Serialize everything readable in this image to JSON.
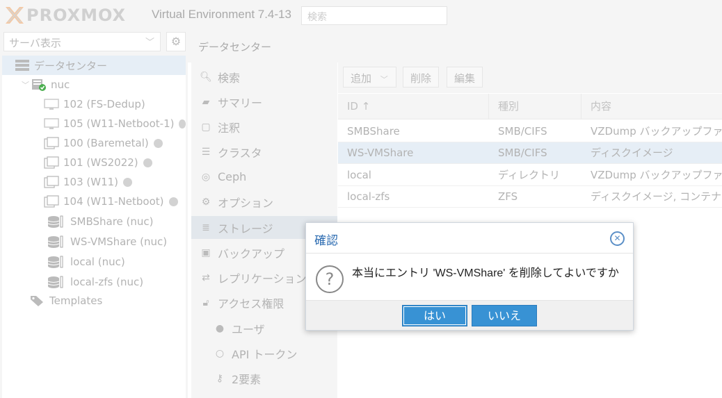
{
  "header": {
    "brand": "PROXMOX",
    "version": "Virtual Environment 7.4-13",
    "search_placeholder": "検索"
  },
  "left": {
    "view_selector": "サーバ表示",
    "tree": [
      {
        "label": "データセンター",
        "icon": "datacenter-icon"
      },
      {
        "label": "nuc",
        "icon": "node-online-icon"
      },
      {
        "label": "102 (FS-Dedup)",
        "icon": "vm-icon"
      },
      {
        "label": "105 (W11-Netboot-1)",
        "icon": "vm-icon"
      },
      {
        "label": "100 (Baremetal)",
        "icon": "template-icon"
      },
      {
        "label": "101 (WS2022)",
        "icon": "template-icon"
      },
      {
        "label": "103 (W11)",
        "icon": "template-icon"
      },
      {
        "label": "104 (W11-Netboot)",
        "icon": "template-icon"
      },
      {
        "label": "SMBShare (nuc)",
        "icon": "storage-icon"
      },
      {
        "label": "WS-VMShare (nuc)",
        "icon": "storage-icon"
      },
      {
        "label": "local (nuc)",
        "icon": "storage-icon"
      },
      {
        "label": "local-zfs (nuc)",
        "icon": "storage-icon"
      },
      {
        "label": "Templates",
        "icon": "tags-icon"
      }
    ]
  },
  "breadcrumb": "データセンター",
  "nav": [
    {
      "label": "検索",
      "icon": "search-icon"
    },
    {
      "label": "サマリー",
      "icon": "book-icon"
    },
    {
      "label": "注釈",
      "icon": "note-icon"
    },
    {
      "label": "クラスタ",
      "icon": "server-icon"
    },
    {
      "label": "Ceph",
      "icon": "ceph-icon"
    },
    {
      "label": "オプション",
      "icon": "gear-icon"
    },
    {
      "label": "ストレージ",
      "icon": "database-icon"
    },
    {
      "label": "バックアップ",
      "icon": "floppy-icon"
    },
    {
      "label": "レプリケーション",
      "icon": "retweet-icon"
    },
    {
      "label": "アクセス権限",
      "icon": "unlock-icon"
    },
    {
      "label": "ユーザ",
      "icon": "user-icon"
    },
    {
      "label": "API トークン",
      "icon": "user-outline-icon"
    },
    {
      "label": "2要素",
      "icon": "key-icon"
    }
  ],
  "toolbar": {
    "add": "追加",
    "remove": "削除",
    "edit": "編集"
  },
  "grid": {
    "columns": [
      "ID ↑",
      "種別",
      "内容"
    ],
    "rows": [
      [
        "SMBShare",
        "SMB/CIFS",
        "VZDump バックアップファイル"
      ],
      [
        "WS-VMShare",
        "SMB/CIFS",
        "ディスクイメージ"
      ],
      [
        "local",
        "ディレクトリ",
        "VZDump バックアップファイル"
      ],
      [
        "local-zfs",
        "ZFS",
        "ディスクイメージ, コンテナ"
      ]
    ]
  },
  "dialog": {
    "title": "確認",
    "message": "本当にエントリ 'WS-VMShare' を削除してよいですか",
    "yes": "はい",
    "no": "いいえ"
  },
  "colors": {
    "accent": "#3892d4",
    "title_text": "#2a6ab0",
    "selection": "#e6eef6",
    "status_ok": "#4caf50"
  }
}
